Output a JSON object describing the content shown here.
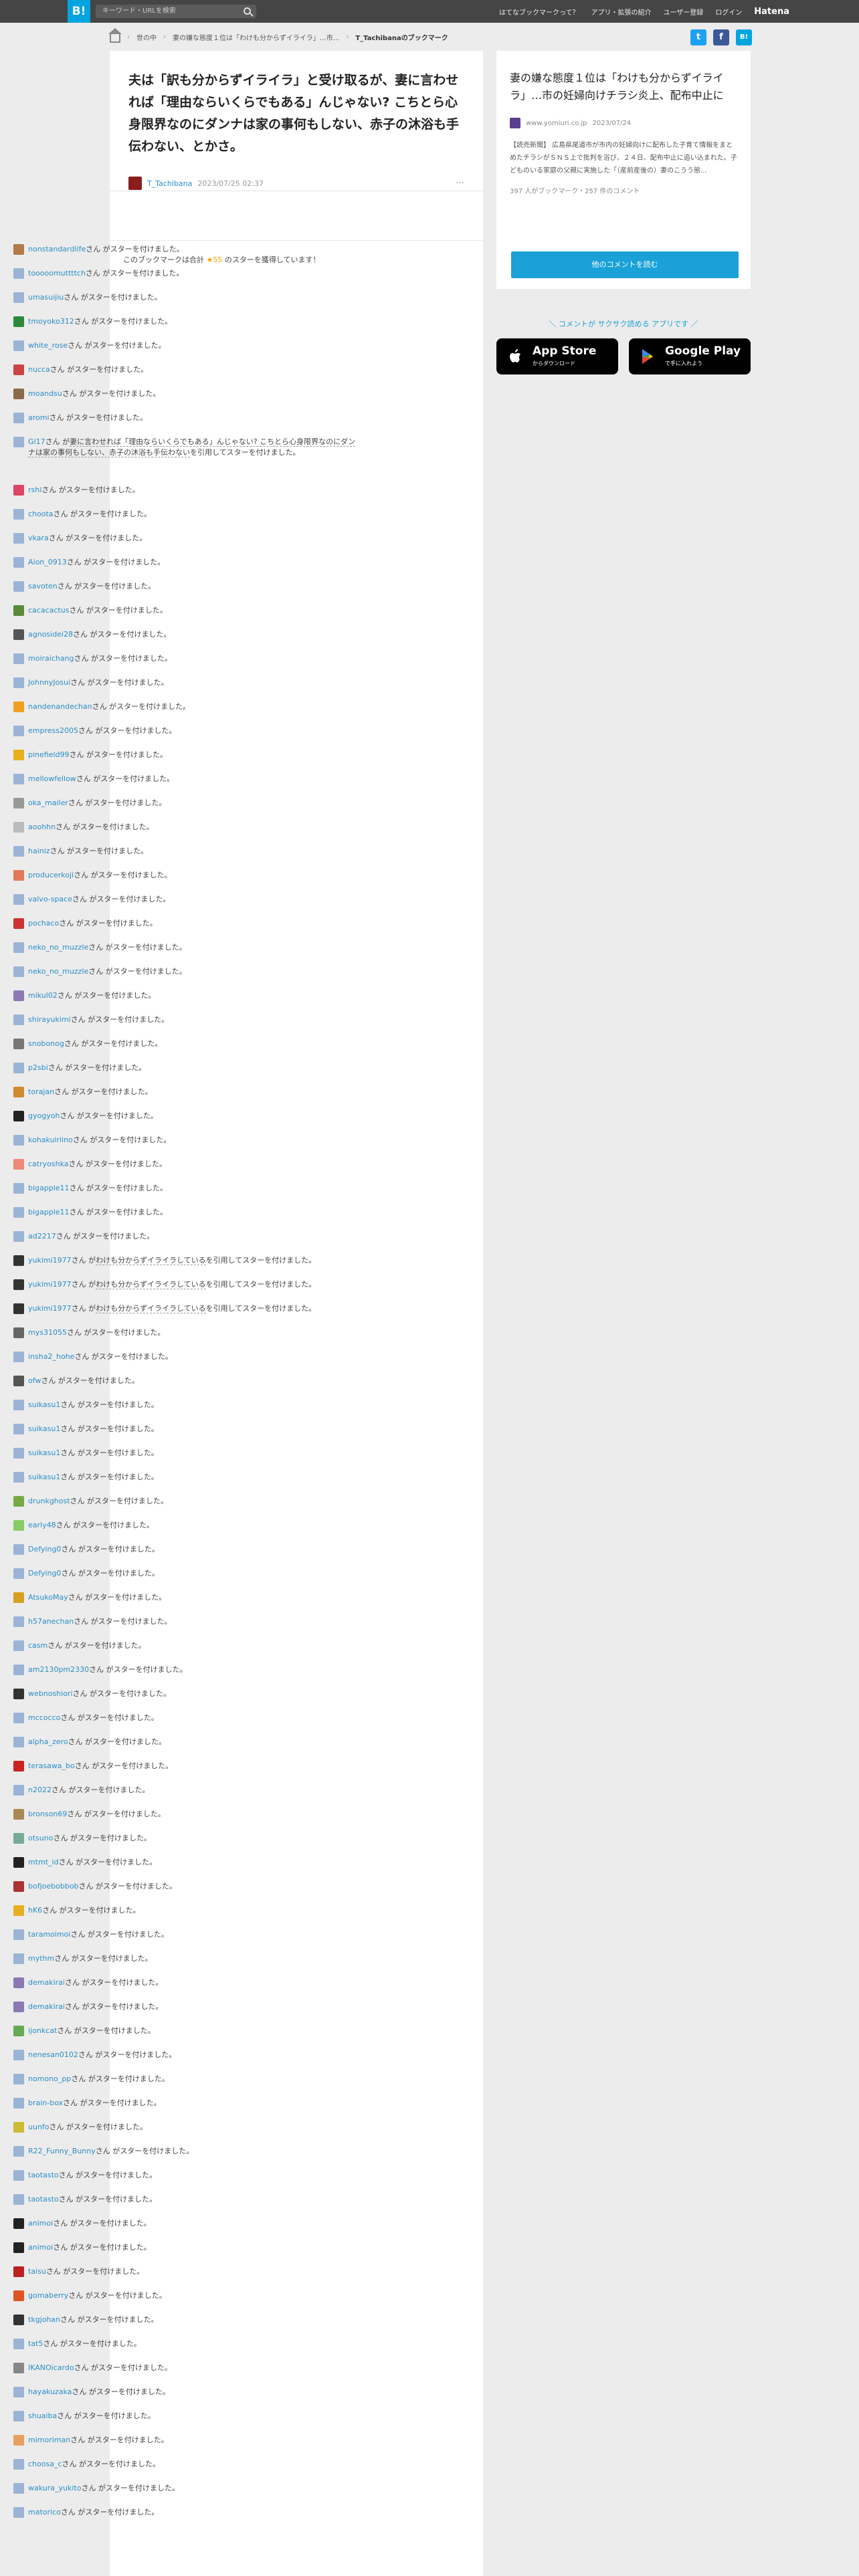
{
  "topbar": {
    "logo": "B!",
    "search_placeholder": "キーワード・URLを検索",
    "links": [
      "はてなブックマークって？",
      "アプリ・拡張の紹介",
      "ユーザー登録",
      "ログイン"
    ],
    "brand": "Hatena"
  },
  "breadcrumb": {
    "category": "世の中",
    "entry": "妻の嫌な態度１位は「わけも分からずイライラ」…市...",
    "current": "T_Tachibanaのブックマーク"
  },
  "main": {
    "title": "夫は「訳も分からずイライラ」と受け取るが、妻に言わせれば「理由ならいくらでもある」んじゃない? こちとら心身限界なのにダンナは家の事何もしない、赤子の沐浴も手伝わない、とかさ。",
    "user": "T_Tachibana",
    "date": "2023/07/25 02:37",
    "more": "···",
    "stars_prefix": "このブックマークは合計",
    "stars_count": "★55",
    "stars_suffix": "のスターを獲得しています！"
  },
  "star_suffix": "さん がスターを付けました。",
  "star_quote_mid": "さん が",
  "star_quote_end": "を引用してスターを付けました。",
  "star_rows": [
    {
      "u": "nonstandardlife",
      "c": "#b07a4a"
    },
    {
      "u": "tooooomuttttch",
      "c": "#9bb4d6"
    },
    {
      "u": "umasuijiu",
      "c": "#9bb4d6"
    },
    {
      "u": "tmoyoko312",
      "c": "#2b8a3e"
    },
    {
      "u": "white_rose",
      "c": "#9bb4d6"
    },
    {
      "u": "nucca",
      "c": "#c44"
    },
    {
      "u": "moandsu",
      "c": "#8a6a4a"
    },
    {
      "u": "aromi",
      "c": "#9bb4d6"
    },
    {
      "u": "Gl17",
      "c": "#9bb4d6",
      "q": "妻に言わせれば「理由ならいくらでもある」んじゃない? こちとら心身限界なのにダンナは家の事何もしない、赤子の沐浴も手伝わない"
    },
    {
      "u": "rshi",
      "c": "#d46"
    },
    {
      "u": "choota",
      "c": "#9bb4d6"
    },
    {
      "u": "vkara",
      "c": "#9bb4d6"
    },
    {
      "u": "Aion_0913",
      "c": "#9bb4d6"
    },
    {
      "u": "savoten",
      "c": "#9bb4d6"
    },
    {
      "u": "cacacactus",
      "c": "#5a8a3a"
    },
    {
      "u": "agnosidei28",
      "c": "#555"
    },
    {
      "u": "moiraichang",
      "c": "#9bb4d6"
    },
    {
      "u": "JohnnyJosui",
      "c": "#9bb4d6"
    },
    {
      "u": "nandenandechan",
      "c": "#f0a020"
    },
    {
      "u": "empress2005",
      "c": "#9bb4d6"
    },
    {
      "u": "pinefield99",
      "c": "#e8b020"
    },
    {
      "u": "mellowfellow",
      "c": "#9bb4d6"
    },
    {
      "u": "oka_mailer",
      "c": "#999"
    },
    {
      "u": "aoohhn",
      "c": "#bbb"
    },
    {
      "u": "hainiz",
      "c": "#9bb4d6"
    },
    {
      "u": "producerkoji",
      "c": "#e07a5a"
    },
    {
      "u": "valvo-space",
      "c": "#9bb4d6"
    },
    {
      "u": "pochaco",
      "c": "#c33"
    },
    {
      "u": "neko_no_muzzle",
      "c": "#9bb4d6"
    },
    {
      "u": "neko_no_muzzle",
      "c": "#9bb4d6"
    },
    {
      "u": "mikul02",
      "c": "#8b79b4"
    },
    {
      "u": "shirayukimi",
      "c": "#9bb4d6"
    },
    {
      "u": "snobonog",
      "c": "#777"
    },
    {
      "u": "p2sbi",
      "c": "#9bb4d6"
    },
    {
      "u": "torajan",
      "c": "#d08a30"
    },
    {
      "u": "gyogyoh",
      "c": "#222"
    },
    {
      "u": "kohakuiriino",
      "c": "#9bb4d6"
    },
    {
      "u": "catryoshka",
      "c": "#e87"
    },
    {
      "u": "bigapple11",
      "c": "#9bb4d6"
    },
    {
      "u": "bigapple11",
      "c": "#9bb4d6"
    },
    {
      "u": "ad2217",
      "c": "#9bb4d6"
    },
    {
      "u": "yukimi1977",
      "c": "#333",
      "q": "わけも分からずイライラしている"
    },
    {
      "u": "yukimi1977",
      "c": "#333",
      "q": "わけも分からずイライラしている"
    },
    {
      "u": "yukimi1977",
      "c": "#333",
      "q": "わけも分からずイライラしている"
    },
    {
      "u": "mys31055",
      "c": "#666"
    },
    {
      "u": "insha2_hohe",
      "c": "#9bb4d6"
    },
    {
      "u": "ofw",
      "c": "#555"
    },
    {
      "u": "suikasu1",
      "c": "#9bb4d6"
    },
    {
      "u": "suikasu1",
      "c": "#9bb4d6"
    },
    {
      "u": "suikasu1",
      "c": "#9bb4d6"
    },
    {
      "u": "suikasu1",
      "c": "#9bb4d6"
    },
    {
      "u": "drunkghost",
      "c": "#7a4"
    },
    {
      "u": "early48",
      "c": "#8c6"
    },
    {
      "u": "Defying0",
      "c": "#9bb4d6"
    },
    {
      "u": "Defying0",
      "c": "#9bb4d6"
    },
    {
      "u": "AtsukoMay",
      "c": "#d5a020"
    },
    {
      "u": "h57anechan",
      "c": "#9bb4d6"
    },
    {
      "u": "casm",
      "c": "#9bb4d6"
    },
    {
      "u": "am2130pm2330",
      "c": "#9bb4d6"
    },
    {
      "u": "webnoshiori",
      "c": "#333"
    },
    {
      "u": "mccocco",
      "c": "#9bb4d6"
    },
    {
      "u": "alpha_zero",
      "c": "#9bb4d6"
    },
    {
      "u": "terasawa_bo",
      "c": "#c22"
    },
    {
      "u": "n2022",
      "c": "#9bb4d6"
    },
    {
      "u": "bronson69",
      "c": "#a85"
    },
    {
      "u": "otsuno",
      "c": "#7a9"
    },
    {
      "u": "mtmt_id",
      "c": "#222"
    },
    {
      "u": "bofjoebobbob",
      "c": "#a33"
    },
    {
      "u": "hK6",
      "c": "#e8b020"
    },
    {
      "u": "taramoimoi",
      "c": "#9bb4d6"
    },
    {
      "u": "mythm",
      "c": "#9bb4d6"
    },
    {
      "u": "demakirai",
      "c": "#8b79b4"
    },
    {
      "u": "demakirai",
      "c": "#8b79b4"
    },
    {
      "u": "ijonkcat",
      "c": "#6a5"
    },
    {
      "u": "nenesan0102",
      "c": "#9bb4d6"
    },
    {
      "u": "nomono_pp",
      "c": "#9bb4d6"
    },
    {
      "u": "brain-box",
      "c": "#9bb4d6"
    },
    {
      "u": "uunfo",
      "c": "#cb3"
    },
    {
      "u": "R22_Funny_Bunny",
      "c": "#9bb4d6"
    },
    {
      "u": "taotasto",
      "c": "#9bb4d6"
    },
    {
      "u": "taotasto",
      "c": "#9bb4d6"
    },
    {
      "u": "animoi",
      "c": "#222"
    },
    {
      "u": "animoi",
      "c": "#222"
    },
    {
      "u": "taisu",
      "c": "#b22"
    },
    {
      "u": "gomaberry",
      "c": "#d52"
    },
    {
      "u": "tkgjohan",
      "c": "#333"
    },
    {
      "u": "tat5",
      "c": "#9bb4d6"
    },
    {
      "u": "IKANOicardo",
      "c": "#888"
    },
    {
      "u": "hayakuzaka",
      "c": "#9bb4d6"
    },
    {
      "u": "shuaiba",
      "c": "#9bb4d6"
    },
    {
      "u": "mimoriman",
      "c": "#e8a060"
    },
    {
      "u": "choosa_c",
      "c": "#9bb4d6"
    },
    {
      "u": "wakura_yukito",
      "c": "#9bb4d6"
    },
    {
      "u": "matorico",
      "c": "#9bb4d6"
    }
  ],
  "side": {
    "title": "妻の嫌な態度１位は「わけも分からずイライラ」…市の妊婦向けチラシ炎上、配布中止に",
    "source": "www.yomiuri.co.jp",
    "date": "2023/07/24",
    "summary": "【読売新聞】 広島県尾道市が市内の妊婦向けに配布した子育て情報をまとめたチラシがＳＮＳ上で批判を浴び、２４日、配布中止に追い込まれた。子どものいる家庭の父親に実施した「（産前産後の）妻のこうう態...",
    "counts": "397 人がブックマーク・257 件のコメント",
    "more_button": "他のコメントを読む",
    "promo": "＼ コメントが サクサク読める アプリです ／",
    "appstore_main": "App Store",
    "appstore_sub": "からダウンロード",
    "googleplay_main": "Google Play",
    "googleplay_sub": "で手に入れよう"
  },
  "colors": {
    "accent": "#00a4de",
    "link": "#2b8dc8",
    "button": "#1aa1d8",
    "star": "#f5a100"
  }
}
